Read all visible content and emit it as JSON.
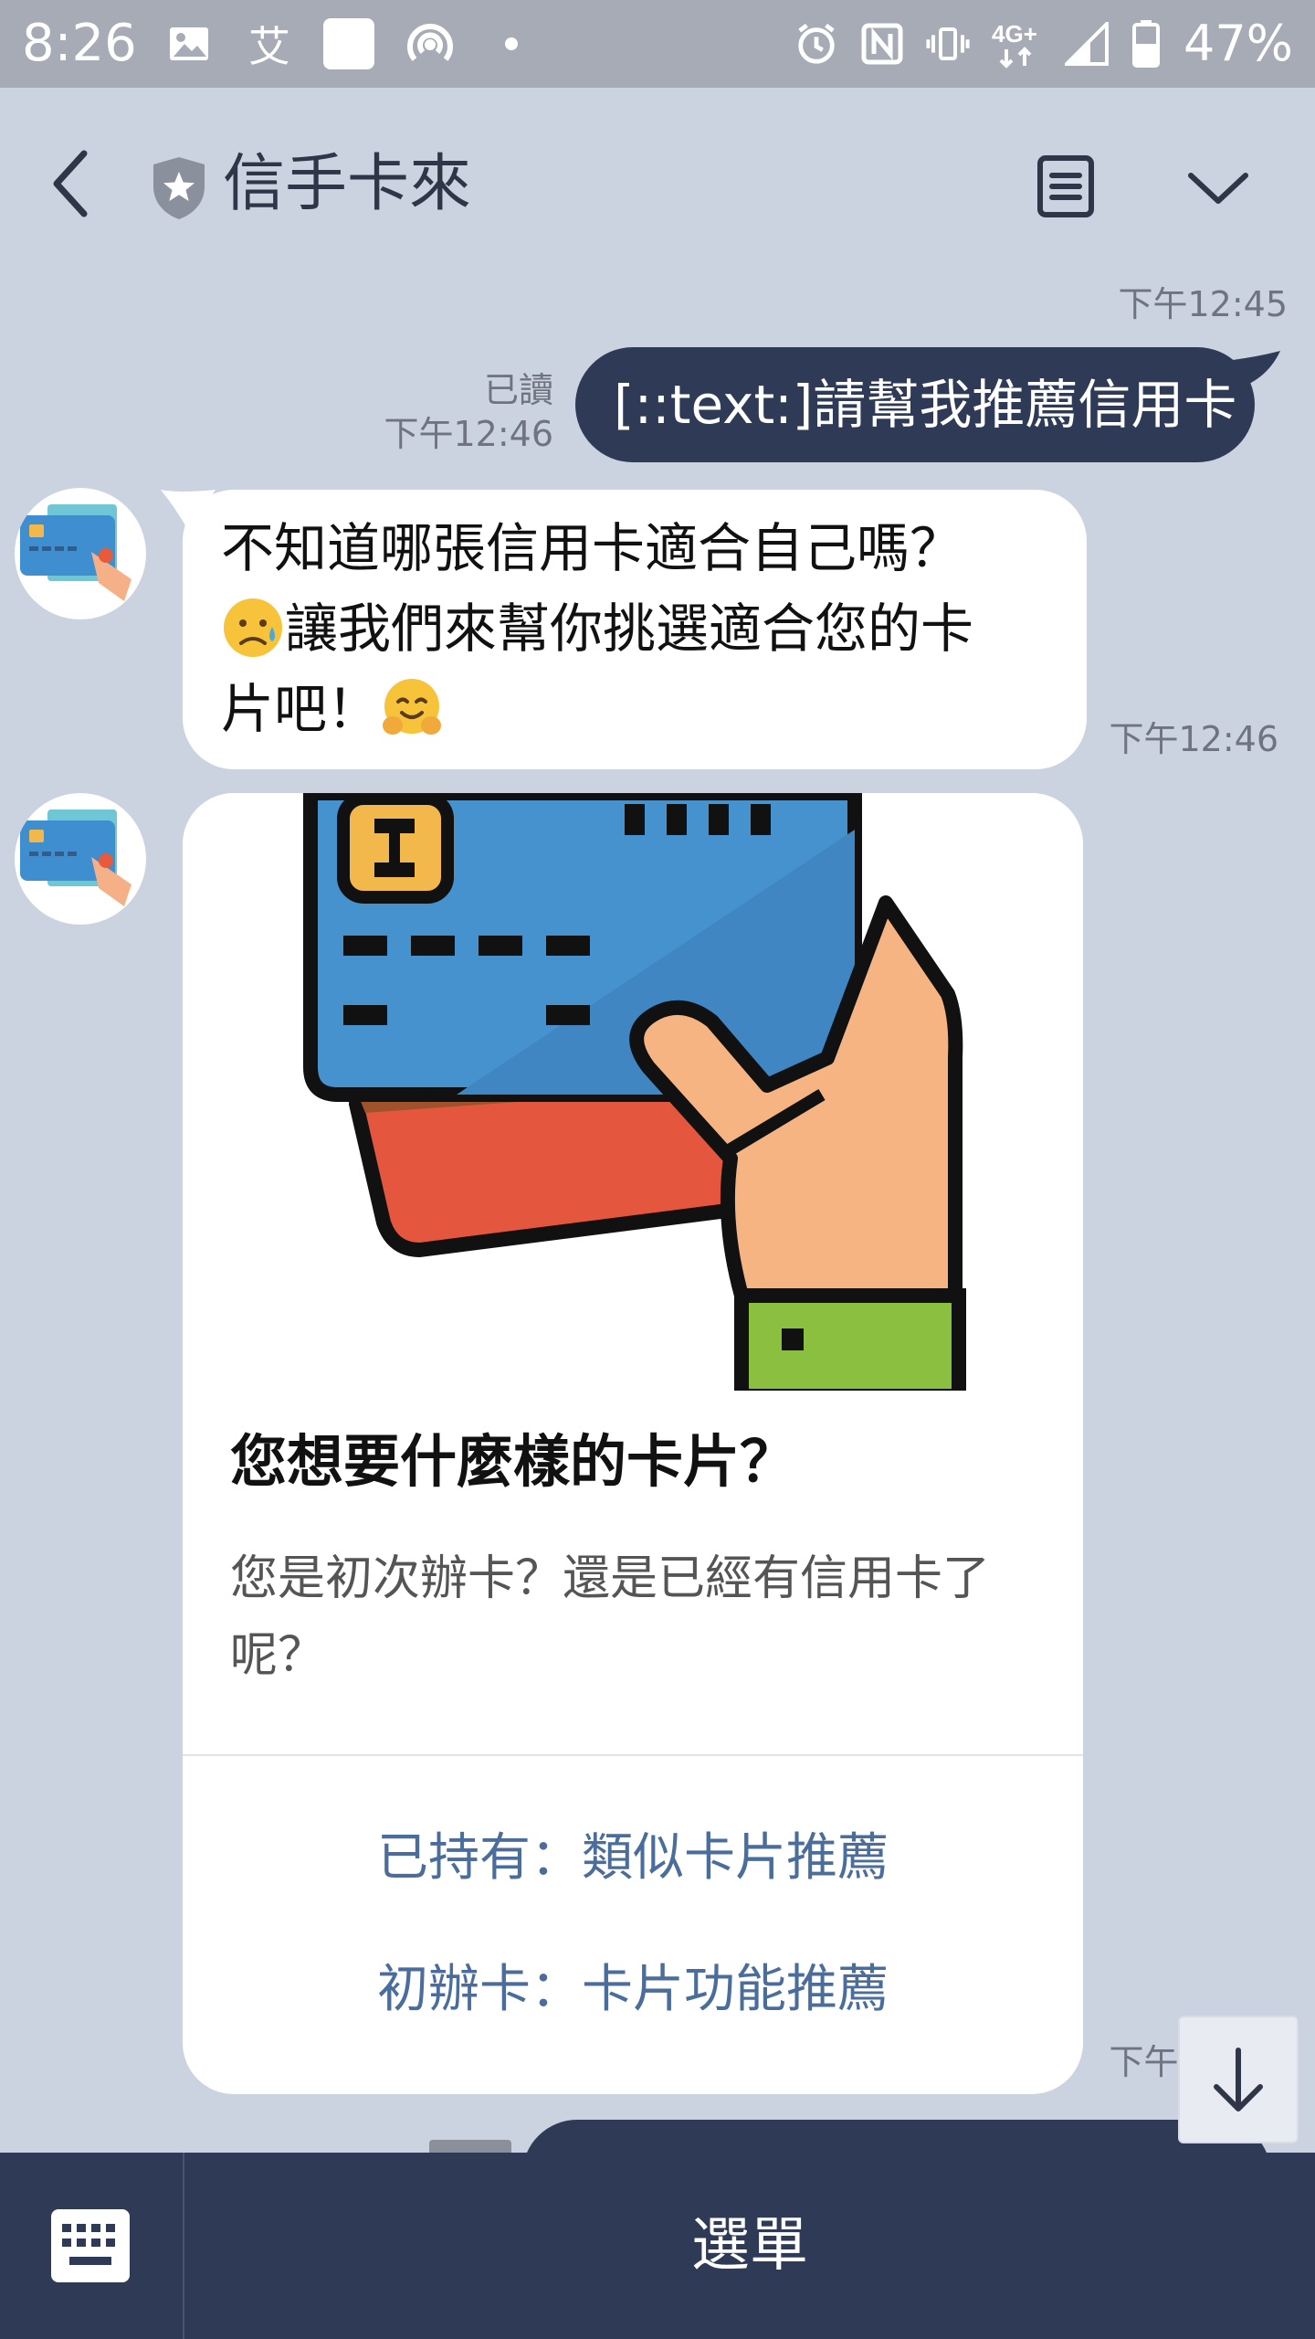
{
  "status_bar": {
    "time": "8:26",
    "left_icons": [
      "image-icon",
      "ai-char-icon",
      "square-app-icon",
      "hotspot-icon",
      "dot-icon"
    ],
    "ai_char": "艾",
    "right_icons": [
      "alarm-icon",
      "nfc-icon",
      "vibrate-icon",
      "4g-plus-icon",
      "signal-icon",
      "battery-icon"
    ],
    "battery_percent": "47%"
  },
  "header": {
    "title": "信手卡來",
    "back_icon": "chevron-left-icon",
    "badge_icon": "shield-star-icon",
    "notes_icon": "notes-icon",
    "expand_icon": "chevron-down-icon"
  },
  "messages": {
    "outgoing_1": {
      "timestamp_top": "下午12:45",
      "read_label": "已讀",
      "timestamp": "下午12:46",
      "text": "[::text:]請幫我推薦信用卡"
    },
    "incoming_1": {
      "line1": "不知道哪張信用卡適合自己嗎？",
      "line2": "讓我們來幫你挑選適合您的卡",
      "line3": "片吧！",
      "timestamp": "下午12:46"
    },
    "card": {
      "title": "您想要什麼樣的卡片？",
      "description": "您是初次辦卡？還是已經有信用卡了呢？",
      "actions": [
        "已持有：類似卡片推薦",
        "初辦卡：卡片功能推薦"
      ],
      "timestamp": "下午12:46"
    }
  },
  "bottom_bar": {
    "keyboard_icon": "keyboard-icon",
    "menu_label": "選單"
  },
  "colors": {
    "background": "#cbd2e0",
    "status_bar": "#a6abb5",
    "outgoing_bubble": "#2f3a56",
    "link": "#4a6d9c",
    "bottom_bar": "#2f3a56"
  }
}
